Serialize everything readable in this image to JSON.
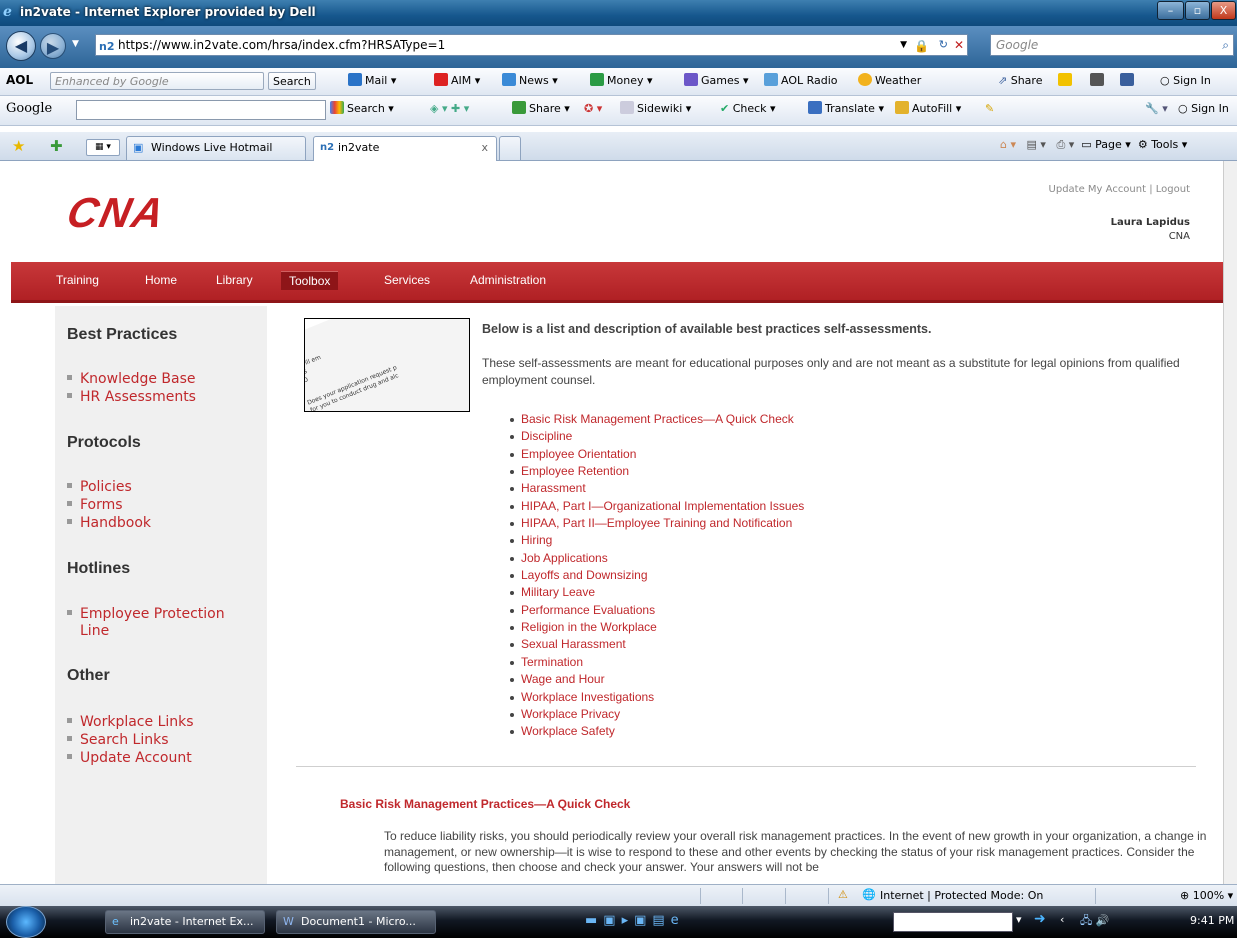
{
  "window": {
    "title": "in2vate - Internet Explorer provided by Dell",
    "minimize": "–",
    "maximize": "▫",
    "close": "X"
  },
  "address": {
    "url": "https://www.in2vate.com/hrsa/index.cfm?HRSAType=1",
    "search_placeholder": "Google"
  },
  "aol_toolbar": {
    "brand": "AOL",
    "search_hint": "Enhanced by Google",
    "search_button": "Search",
    "mail": "Mail",
    "aim": "AIM",
    "news": "News",
    "money": "Money",
    "games": "Games",
    "radio": "AOL Radio",
    "weather": "Weather",
    "share": "Share",
    "signin": "Sign In"
  },
  "google_toolbar": {
    "brand": "Google",
    "search": "Search",
    "share": "Share",
    "sidewiki": "Sidewiki",
    "check": "Check",
    "translate": "Translate",
    "autofill": "AutoFill",
    "signin": "Sign In"
  },
  "tabs": {
    "hotmail": "Windows Live Hotmail",
    "active": "in2vate",
    "close": "x",
    "page_menu": "Page",
    "tools_menu": "Tools"
  },
  "site": {
    "logo": "CNA",
    "account_links": "Update My Account | Logout",
    "user_name": "Laura Lapidus",
    "user_org": "CNA",
    "nav": [
      "Training",
      "Home",
      "Library",
      "Toolbox",
      "Services",
      "Administration"
    ]
  },
  "sidebar": {
    "best_practices": {
      "heading": "Best Practices",
      "items": [
        "Knowledge Base",
        "HR Assessments"
      ]
    },
    "protocols": {
      "heading": "Protocols",
      "items": [
        "Policies",
        "Forms",
        "Handbook"
      ]
    },
    "hotlines": {
      "heading": "Hotlines",
      "items": [
        "Employee Protection",
        "Line"
      ]
    },
    "other": {
      "heading": "Other",
      "items": [
        "Workplace Links",
        "Search Links",
        "Update Account"
      ]
    }
  },
  "thumbnail": {
    "lines": [
      "Does your application request p",
      "for you to conduct drug and alc",
      "at will em",
      "YES",
      "NO"
    ]
  },
  "content": {
    "intro_title": "Below is a list and description of available best practices self-assessments.",
    "intro_body": "These self-assessments are meant for educational purposes only and are not meant as a substitute for legal opinions from qualified employment counsel.",
    "assessments": [
      "Basic Risk Management Practices—A Quick Check",
      "Discipline",
      "Employee Orientation",
      "Employee Retention",
      "Harassment",
      "HIPAA, Part I—Organizational Implementation Issues",
      "HIPAA, Part II—Employee Training and Notification",
      "Hiring",
      "Job Applications",
      "Layoffs and Downsizing",
      "Military Leave",
      "Performance Evaluations",
      "Religion in the Workplace",
      "Sexual Harassment",
      "Termination",
      "Wage and Hour",
      "Workplace Investigations",
      "Workplace Privacy",
      "Workplace Safety"
    ],
    "section_title": "Basic Risk Management Practices—A Quick Check",
    "section_body": "To reduce liability risks, you should periodically review your overall risk management practices. In the event of new growth in your organization, a change in management, or new ownership—it is wise to respond to these and other events by checking the status of your risk management practices. Consider the following questions, then choose and check your answer. Your answers will not be"
  },
  "status": {
    "zone": "Internet | Protected Mode: On",
    "zoom": "100%"
  },
  "taskbar": {
    "ie_task": "in2vate - Internet Ex...",
    "word_task": "Document1 - Micro...",
    "clock": "9:41 PM"
  }
}
